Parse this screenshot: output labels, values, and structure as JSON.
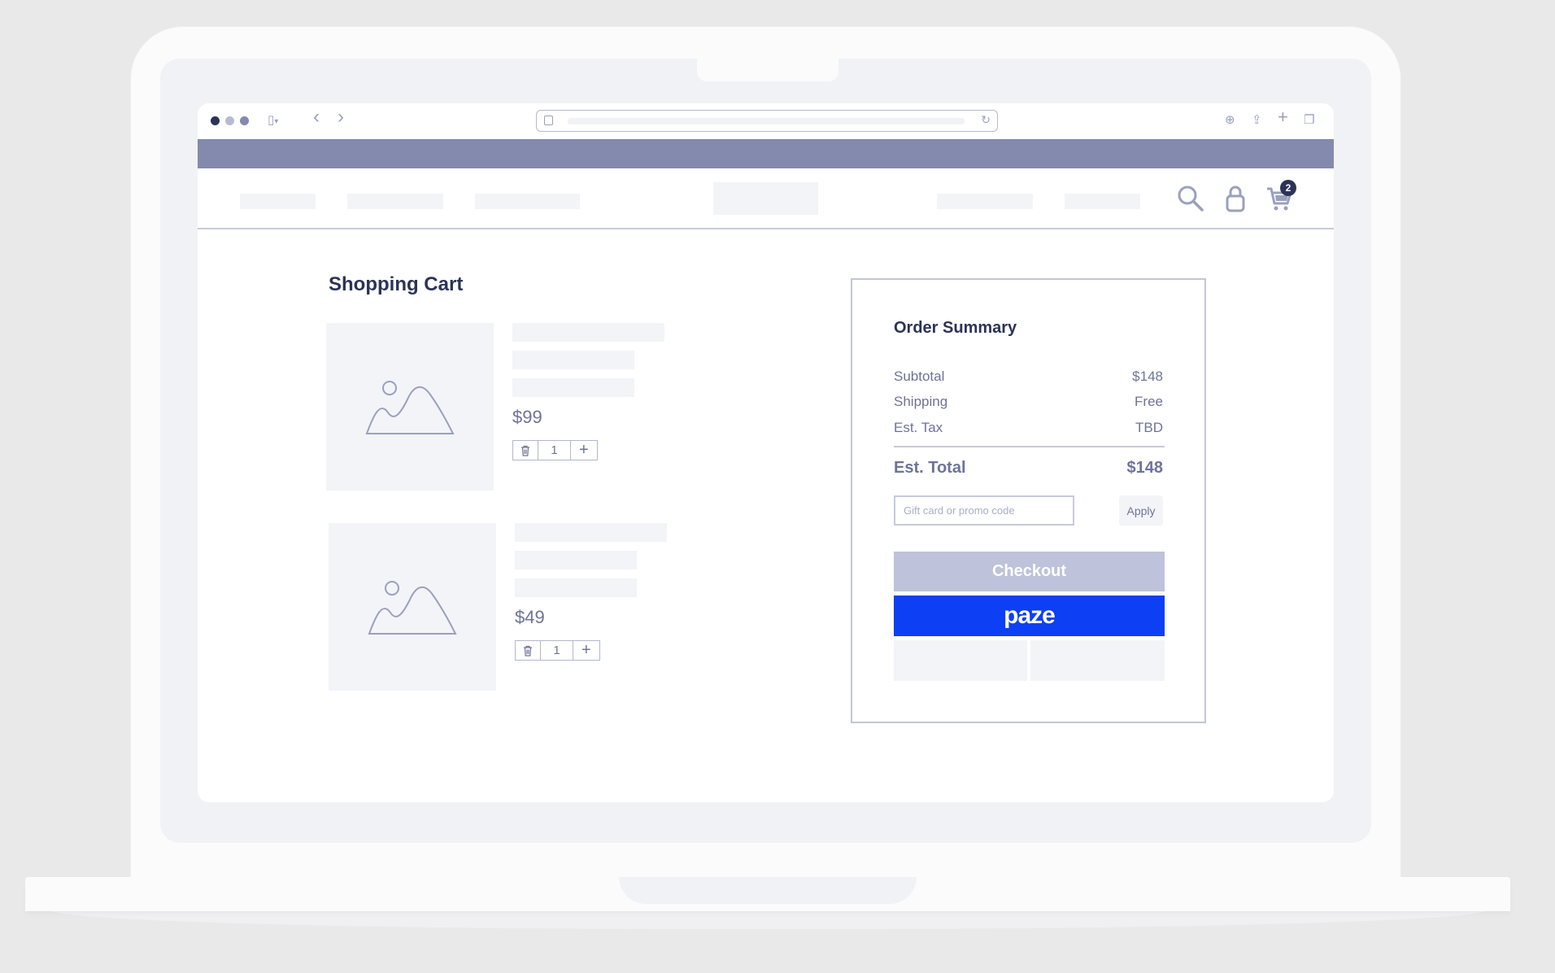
{
  "browser": {
    "window_controls": [
      "close",
      "minimize",
      "maximize"
    ],
    "icons": {
      "sidebar": "sidebar-icon",
      "back": "chevron-left-icon",
      "forward": "chevron-right-icon",
      "site": "site-info-icon",
      "reload": "reload-icon",
      "download": "download-icon",
      "share": "share-icon",
      "new_tab": "plus-icon",
      "tabs": "tabs-icon"
    },
    "glyphs": {
      "sidebar": "▯",
      "sidebar_caret": "▾",
      "back": "‹",
      "forward": "›",
      "reload": "↻",
      "download": "⊕",
      "share": "⇪",
      "new_tab": "+",
      "tabs": "❐"
    }
  },
  "site_header": {
    "cart_badge": "2",
    "icons": {
      "search": "search-icon",
      "account": "user-icon",
      "cart": "cart-icon"
    }
  },
  "cart": {
    "title": "Shopping Cart",
    "items": [
      {
        "price": "$99",
        "quantity": "1",
        "plus": "+"
      },
      {
        "price": "$49",
        "quantity": "1",
        "plus": "+"
      }
    ]
  },
  "summary": {
    "title": "Order Summary",
    "rows": [
      {
        "label": "Subtotal",
        "value": "$148"
      },
      {
        "label": "Shipping",
        "value": "Free"
      },
      {
        "label": "Est. Tax",
        "value": "TBD"
      }
    ],
    "total": {
      "label": "Est. Total",
      "value": "$148"
    },
    "promo_placeholder": "Gift card or promo code",
    "apply_label": "Apply",
    "checkout_label": "Checkout",
    "paze_label": "paze"
  },
  "colors": {
    "banner": "#838aae",
    "paze": "#0d3ff5",
    "checkout": "#bec2da",
    "text_dark": "#2c3357",
    "text_muted": "#6d7399"
  }
}
